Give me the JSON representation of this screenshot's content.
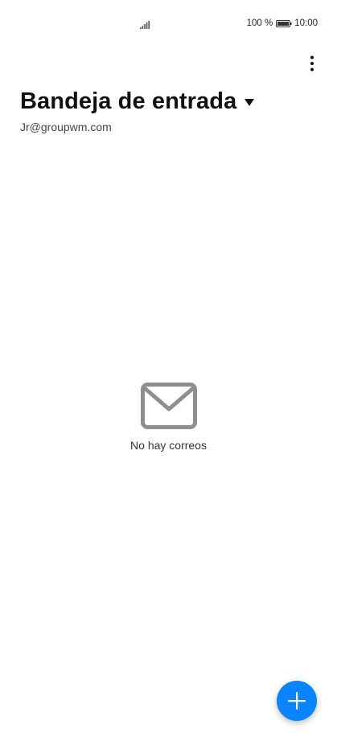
{
  "status_bar": {
    "battery_percent": "100 %",
    "time": "10:00",
    "icons": [
      "signal-icon",
      "battery-icon"
    ]
  },
  "toolbar": {
    "more_icon": "more-vertical-icon"
  },
  "header": {
    "title": "Bandeja de entrada",
    "account": "Jr@groupwm.com",
    "dropdown_icon": "caret-down-icon"
  },
  "empty_state": {
    "icon": "mail-icon",
    "message": "No hay correos"
  },
  "fab": {
    "icon": "plus-icon"
  },
  "colors": {
    "accent": "#0a84ff",
    "icon_gray": "#8e8e8e",
    "background": "#ffffff"
  }
}
